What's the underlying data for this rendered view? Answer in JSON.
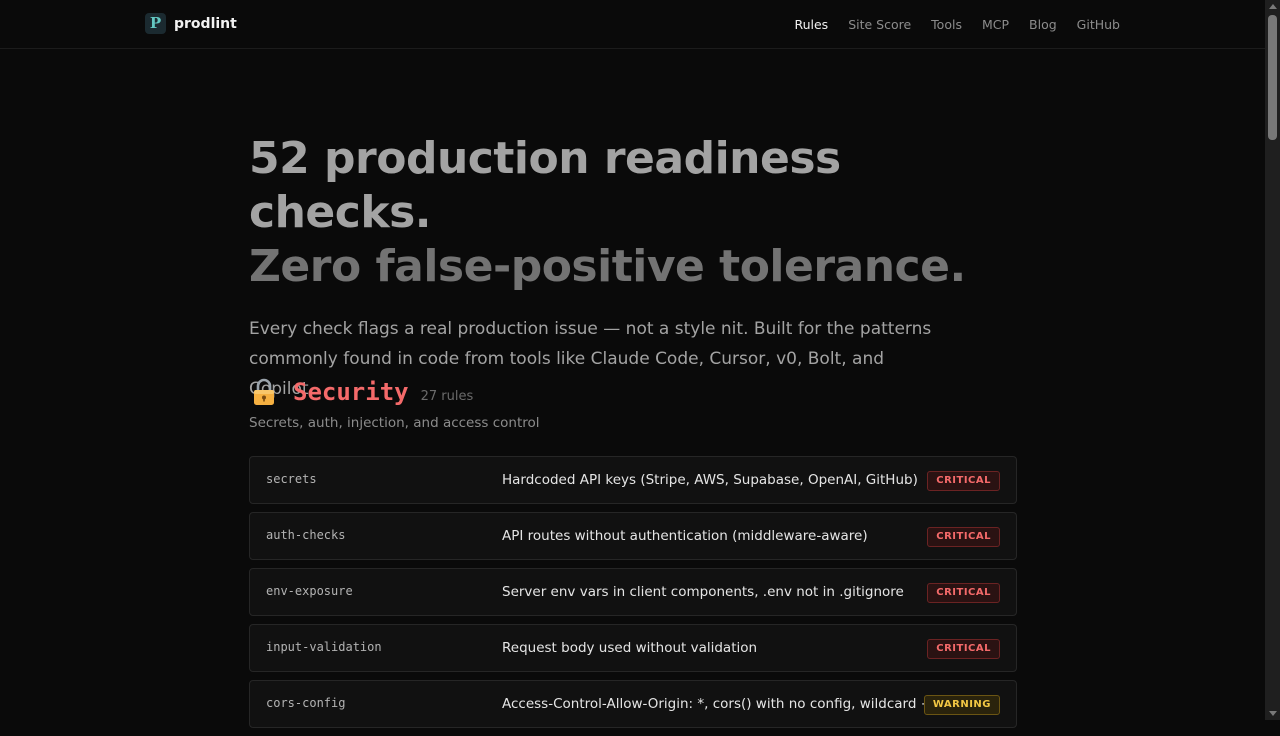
{
  "brand": {
    "name": "prodlint",
    "logo_letter": "P"
  },
  "nav": [
    {
      "label": "Rules",
      "active": true
    },
    {
      "label": "Site Score",
      "active": false
    },
    {
      "label": "Tools",
      "active": false
    },
    {
      "label": "MCP",
      "active": false
    },
    {
      "label": "Blog",
      "active": false
    },
    {
      "label": "GitHub",
      "active": false
    }
  ],
  "hero": {
    "line1": "52 production readiness checks.",
    "line2": "Zero false-positive tolerance.",
    "subtitle": "Every check flags a real production issue — not a style nit. Built for the patterns commonly found in code from tools like Claude Code, Cursor, v0, Bolt, and Copilot."
  },
  "section": {
    "icon": "lock-icon",
    "title": "Security",
    "count": "27 rules",
    "description": "Secrets, auth, injection, and access control",
    "accent": "#f46a6a"
  },
  "rules": [
    {
      "name": "secrets",
      "description": "Hardcoded API keys (Stripe, AWS, Supabase, OpenAI, GitHub)",
      "severity": "CRITICAL",
      "level": "critical"
    },
    {
      "name": "auth-checks",
      "description": "API routes without authentication (middleware-aware)",
      "severity": "CRITICAL",
      "level": "critical"
    },
    {
      "name": "env-exposure",
      "description": "Server env vars in client components, .env not in .gitignore",
      "severity": "CRITICAL",
      "level": "critical"
    },
    {
      "name": "input-validation",
      "description": "Request body used without validation",
      "severity": "CRITICAL",
      "level": "critical"
    },
    {
      "name": "cors-config",
      "description": "Access-Control-Allow-Origin: *, cors() with no config, wildcard +",
      "severity": "WARNING",
      "level": "warning"
    }
  ]
}
